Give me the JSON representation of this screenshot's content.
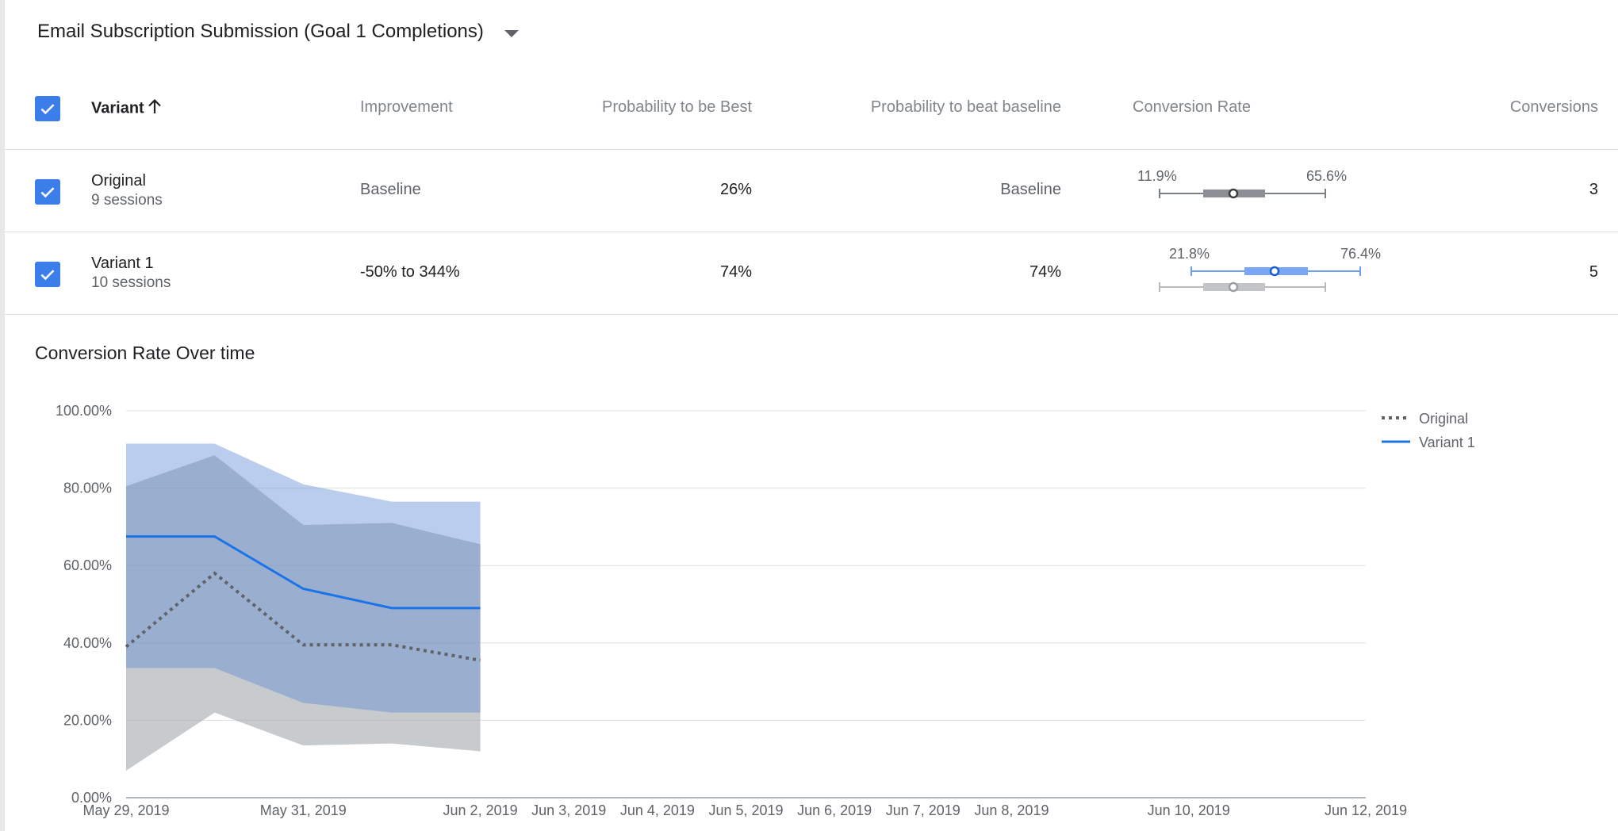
{
  "metric": {
    "title": "Email Subscription Submission (Goal 1 Completions)"
  },
  "table": {
    "headers": {
      "variant": "Variant",
      "improvement": "Improvement",
      "prob_best": "Probability to be Best",
      "prob_baseline": "Probability to beat baseline",
      "conv_rate": "Conversion Rate",
      "conversions": "Conversions"
    },
    "rows": [
      {
        "name": "Original",
        "sessions": "9 sessions",
        "improvement": "Baseline",
        "prob_best": "26%",
        "prob_baseline": "Baseline",
        "ci_low": "11.9%",
        "ci_high": "65.6%",
        "conversions": "3"
      },
      {
        "name": "Variant 1",
        "sessions": "10 sessions",
        "improvement": "-50% to 344%",
        "prob_best": "74%",
        "prob_baseline": "74%",
        "ci_low": "21.8%",
        "ci_high": "76.4%",
        "conversions": "5"
      }
    ]
  },
  "colors": {
    "accent": "#3b7de9",
    "variant": "#1a73e8",
    "original": "#5f6368"
  },
  "chart_data": {
    "type": "line",
    "title": "Conversion Rate Over time",
    "x": [
      "May 29, 2019",
      "May 30, 2019",
      "May 31, 2019",
      "Jun 1, 2019",
      "Jun 2, 2019"
    ],
    "x_ticks": [
      "May 29, 2019",
      "May 31, 2019",
      "Jun 2, 2019",
      "Jun 3, 2019",
      "Jun 4, 2019",
      "Jun 5, 2019",
      "Jun 6, 2019",
      "Jun 7, 2019",
      "Jun 8, 2019",
      "Jun 10, 2019",
      "Jun 12, 2019"
    ],
    "xlim": [
      "May 29, 2019",
      "Jun 12, 2019"
    ],
    "y_ticks": [
      "0.00%",
      "20.00%",
      "40.00%",
      "60.00%",
      "80.00%",
      "100.00%"
    ],
    "ylim": [
      0,
      100
    ],
    "grid": true,
    "legend": "top-right",
    "series": [
      {
        "name": "Original",
        "style": "dotted",
        "color": "#5f6368",
        "values": [
          39,
          58,
          39.5,
          39.5,
          35.5
        ],
        "lower": [
          7,
          22,
          13.5,
          14,
          12
        ],
        "upper": [
          80.5,
          88.5,
          70.5,
          71,
          65.5
        ]
      },
      {
        "name": "Variant 1",
        "style": "solid",
        "color": "#1a73e8",
        "values": [
          67.5,
          67.5,
          54,
          49,
          49
        ],
        "lower": [
          33.5,
          33.5,
          24.5,
          22,
          22
        ],
        "upper": [
          91.5,
          91.5,
          81,
          76.5,
          76.5
        ]
      }
    ]
  }
}
